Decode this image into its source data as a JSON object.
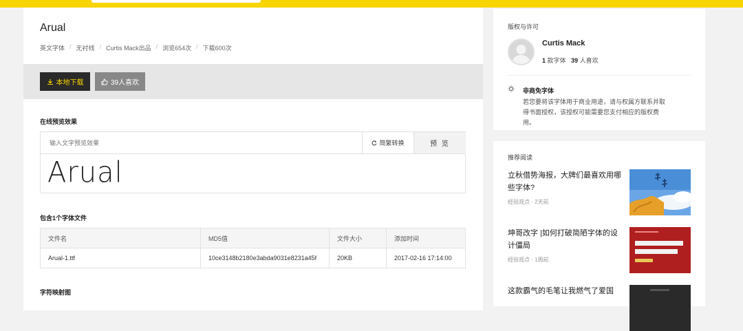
{
  "main": {
    "font_name": "Arual",
    "meta": [
      "英文字体",
      "无衬线",
      "Curtis Mack出品",
      "浏览654次",
      "下载600次"
    ],
    "download_label": "本地下载",
    "like_label": "39人喜欢",
    "preview_section_label": "在线预览效果",
    "preview_placeholder": "输入文字预览效果",
    "convert_label": "简繁转换",
    "preview_label": "预 览",
    "preview_text": "Arual",
    "files_section_label": "包含1个字体文件",
    "files_table": {
      "headers": [
        "文件名",
        "MD5值",
        "文件大小",
        "添加时间"
      ],
      "rows": [
        [
          "Arual-1.ttf",
          "10ce3148b2180e3abda9031e8231a45f",
          "20KB",
          "2017-02-16 17:14:00"
        ]
      ]
    },
    "glyph_section_label": "字符映射图"
  },
  "sidebar": {
    "copyright_heading": "版权与许可",
    "author_name": "Curtis Mack",
    "font_count": "1",
    "font_count_unit": "款字体",
    "likes_count": "39",
    "likes_unit": "人喜欢",
    "license_title": "非商免字体",
    "license_desc": "若您要将该字体用于商业用途，请与权属方联系并取得书面授权，该授权可能需要您支付相应的版权费用。",
    "recommend_heading": "推荐阅读",
    "articles": [
      {
        "title": "立秋借势海报，大牌们最喜欢用哪些字体?",
        "meta": "经验观点 · 2天前"
      },
      {
        "title": "坤哥改字 |如何打破简陋字体的设计僵局",
        "meta": "经验观点 · 1周前"
      },
      {
        "title": "这款霸气的毛笔让我燃气了爱国"
      }
    ]
  },
  "colors": {
    "accent_yellow": "#f8d400",
    "dark_button": "#2a2a2a",
    "gray_button": "#888888"
  }
}
